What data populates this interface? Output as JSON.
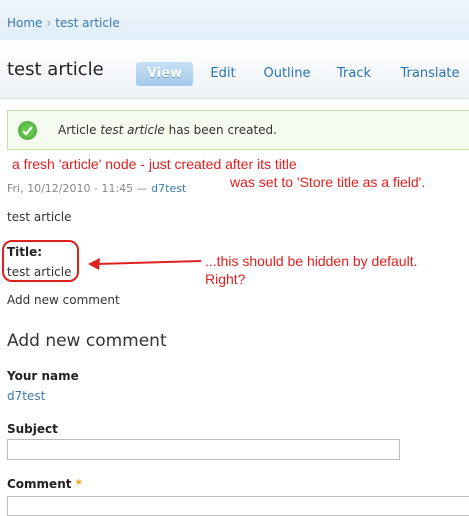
{
  "breadcrumb": {
    "items": [
      "Home",
      "test article"
    ],
    "separator": "›"
  },
  "header": {
    "title": "test article",
    "tabs": [
      {
        "label": "View",
        "active": true
      },
      {
        "label": "Edit"
      },
      {
        "label": "Outline"
      },
      {
        "label": "Track"
      },
      {
        "label": "Translate"
      }
    ]
  },
  "status": {
    "prefix": "Article ",
    "node_title": "test article",
    "suffix": " has been created.",
    "icon": "check-icon",
    "color": "#3d9a2b"
  },
  "annotations": {
    "note1_line1": "a fresh 'article' node - just created after its title",
    "note1_line2": "was set to 'Store title as a field'.",
    "note2_line1": "...this should be hidden by default.",
    "note2_line2": "Right?",
    "color": "#e02020"
  },
  "node": {
    "submitted_date": "Fri, 10/12/2010 - 11:45 —",
    "author": "d7test",
    "body": "test article",
    "title_field_label": "Title:",
    "title_field_value": "test article"
  },
  "links": {
    "add_new_comment": "Add new comment"
  },
  "comment_form": {
    "heading": "Add new comment",
    "your_name_label": "Your name",
    "your_name_value": "d7test",
    "subject_label": "Subject",
    "comment_label": "Comment",
    "required_marker": "*"
  }
}
